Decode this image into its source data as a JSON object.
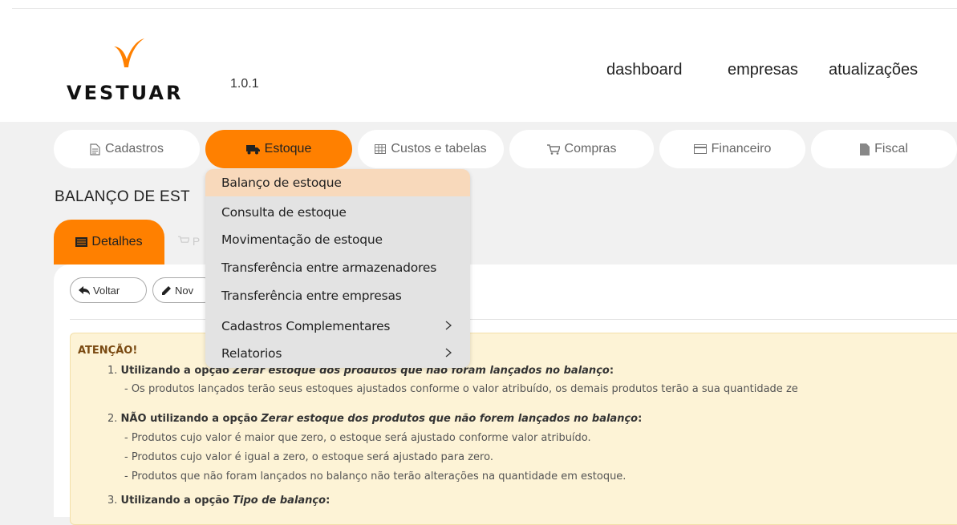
{
  "brand": {
    "name": "VESTUAR",
    "version": "1.0.1",
    "accent": "#ff8000"
  },
  "topnav": [
    "dashboard",
    "empresas",
    "atualizações"
  ],
  "tabs": [
    {
      "label": "Cadastros",
      "icon": "document-icon"
    },
    {
      "label": "Estoque",
      "icon": "truck-icon"
    },
    {
      "label": "Custos e tabelas",
      "icon": "table-icon"
    },
    {
      "label": "Compras",
      "icon": "cart-icon"
    },
    {
      "label": "Financeiro",
      "icon": "credit-card-icon"
    },
    {
      "label": "Fiscal",
      "icon": "file-icon"
    }
  ],
  "page_title": "BALANÇO DE EST",
  "subtabs": {
    "active": "Detalhes",
    "ghost": "P"
  },
  "buttons": {
    "back": "Voltar",
    "new": "Nov"
  },
  "menu": {
    "items": [
      "Balanço de estoque",
      "Consulta de estoque",
      "Movimentação de estoque",
      "Transferência entre armazenadores",
      "Transferência entre empresas",
      "Cadastros Complementares",
      "Relatorios"
    ],
    "hovered": "Balanço de estoque"
  },
  "alert": {
    "title": "ATENÇÃO!",
    "i1_num": "1.",
    "i1_b": "Utilizando a opção",
    "i1_i": "Zerar estoque dos produtos que não foram lançados no balanço",
    "i1_d": "- Os produtos lançados terão seus estoques ajustados conforme o valor atribuído, os demais produtos terão a sua quantidade ze",
    "i2_num": "2.",
    "i2_b": "NÃO utilizando a opção",
    "i2_i": "Zerar estoque dos produtos que não forem lançados no balanço",
    "i2_d1": "- Produtos cujo valor é maior que zero, o estoque será ajustado conforme valor atribuído.",
    "i2_d2": "- Produtos cujo valor é igual a zero, o estoque será ajustado para zero.",
    "i2_d3": "- Produtos que não foram lançados no balanço não terão alterações na quantidade em estoque.",
    "i3_num": "3.",
    "i3_b": "Utilizando a opção",
    "i3_i": "Tipo de balanço"
  }
}
